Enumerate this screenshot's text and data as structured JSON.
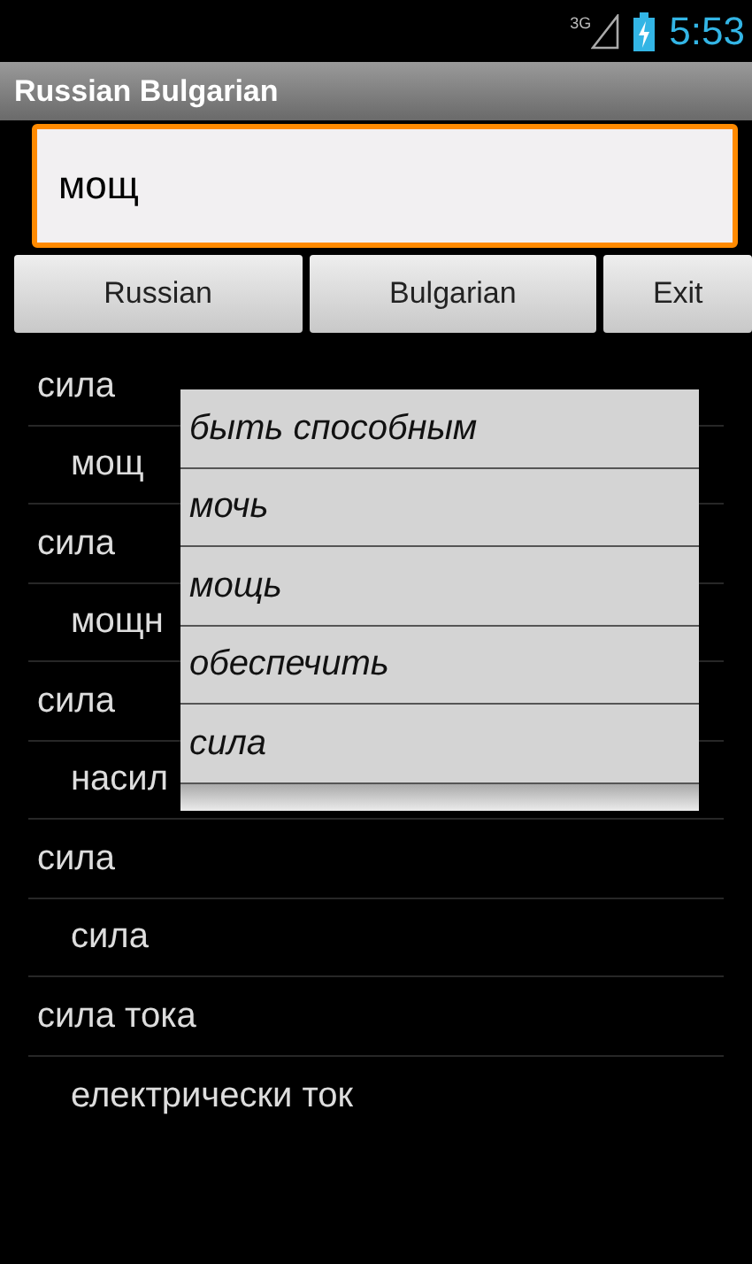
{
  "status_bar": {
    "network": "3G",
    "time": "5:53"
  },
  "window": {
    "title": "Russian Bulgarian"
  },
  "search": {
    "value": "мощ"
  },
  "buttons": [
    {
      "label": "Russian"
    },
    {
      "label": "Bulgarian"
    },
    {
      "label": "Exit"
    }
  ],
  "results": [
    {
      "kind": "word",
      "text": "сила"
    },
    {
      "kind": "translation",
      "text": "мощ"
    },
    {
      "kind": "word",
      "text": "сила"
    },
    {
      "kind": "translation",
      "text": "мощн"
    },
    {
      "kind": "word",
      "text": "сила"
    },
    {
      "kind": "translation",
      "text": "насил"
    },
    {
      "kind": "word",
      "text": "сила"
    },
    {
      "kind": "translation",
      "text": "сила"
    },
    {
      "kind": "word",
      "text": "сила тока"
    },
    {
      "kind": "translation",
      "text": "електрически ток"
    }
  ],
  "suggestions": [
    "быть способным",
    "мочь",
    "мощь",
    "обеспечить",
    "сила"
  ]
}
